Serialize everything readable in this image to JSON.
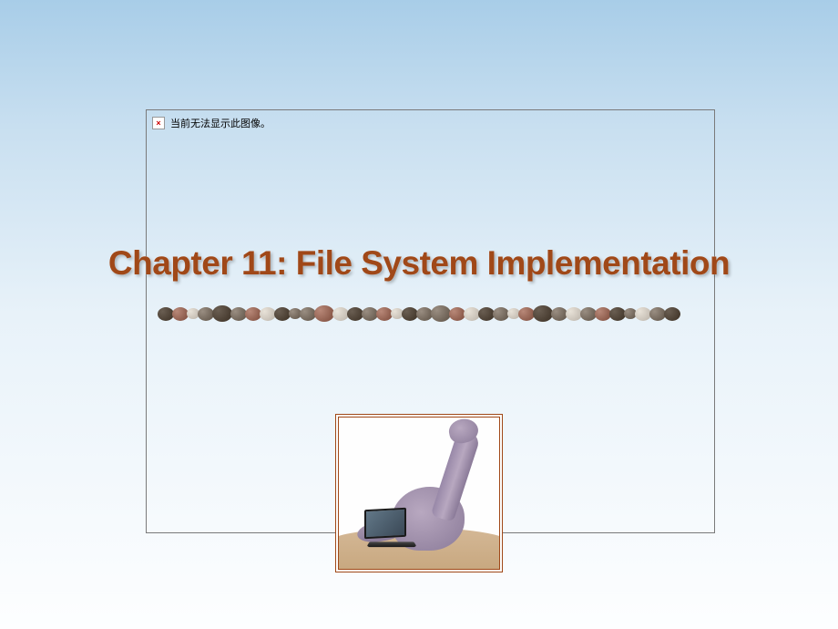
{
  "title": "Chapter 11:  File System Implementation",
  "broken_image": {
    "label": "当前无法显示此图像。"
  }
}
